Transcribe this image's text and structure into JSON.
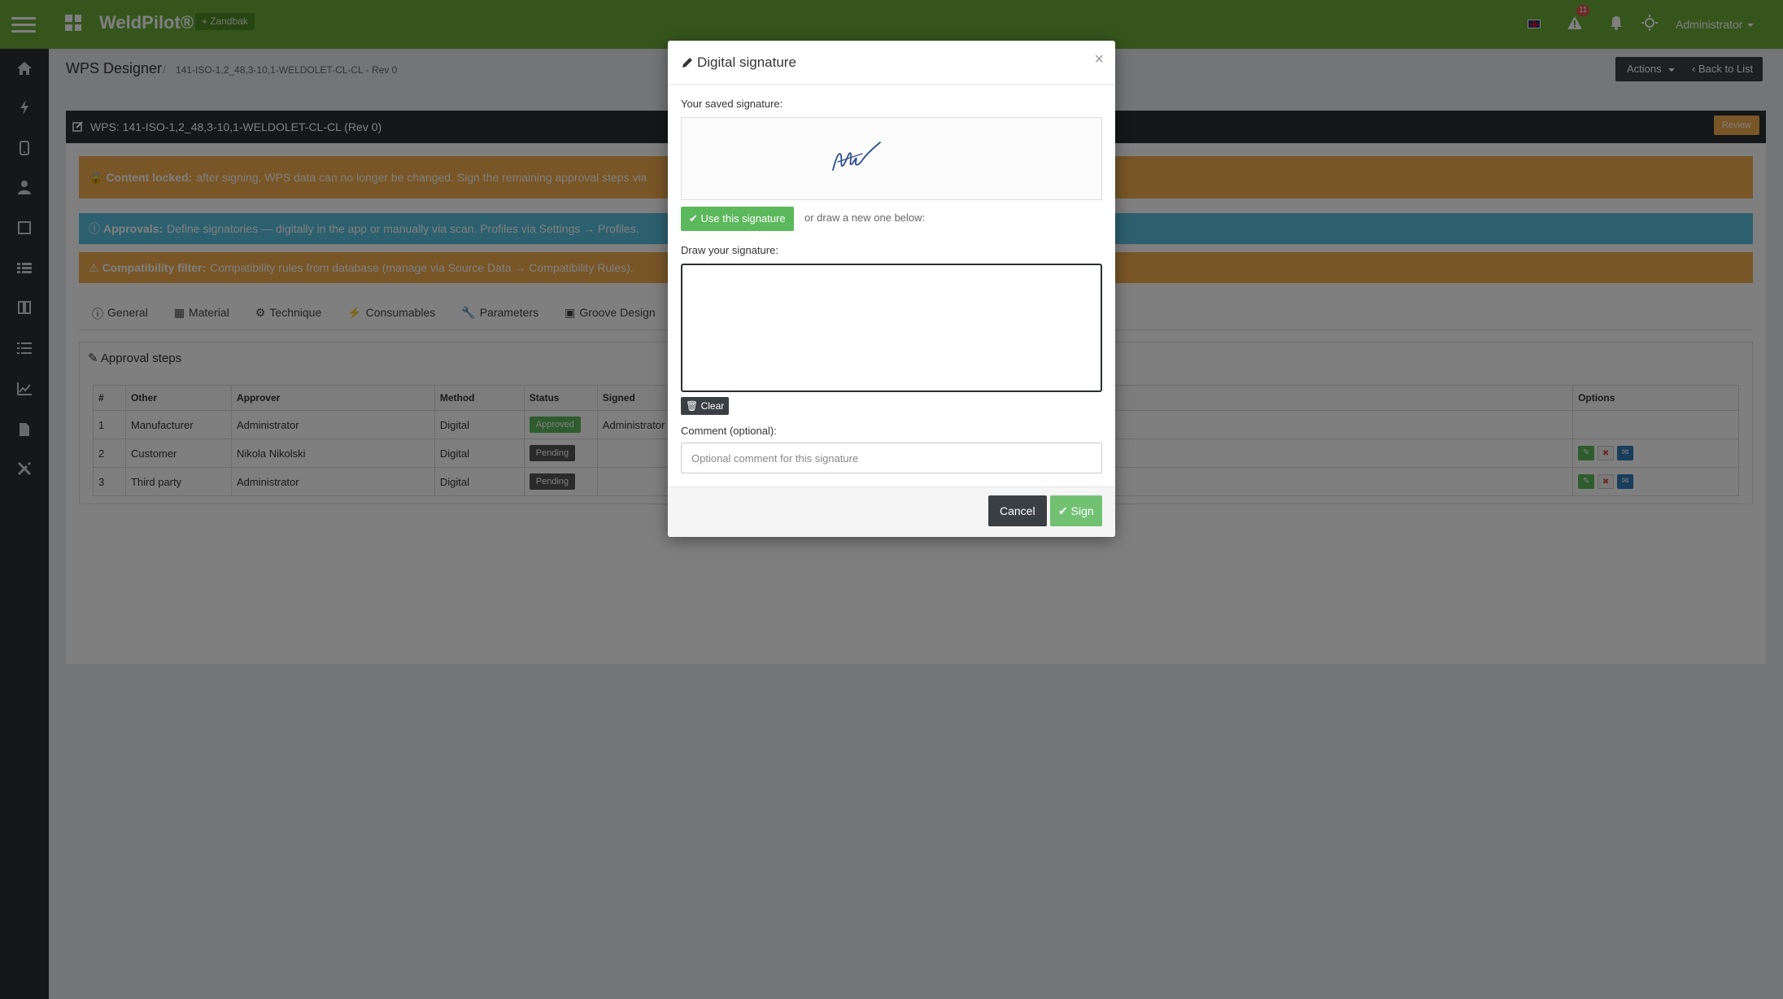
{
  "app": {
    "brand": "WeldPilot®",
    "environment": "Zandbak",
    "alert_count": "11",
    "user": "Administrator"
  },
  "page": {
    "title": "WPS Designer",
    "breadcrumb": "141-ISO-1,2_48,3-10,1-WELDOLET-CL-CL - Rev 0",
    "actions_label": "Actions",
    "back_label": "Back to List"
  },
  "panel": {
    "title": "WPS: 141-ISO-1,2_48,3-10,1-WELDOLET-CL-CL (Rev 0)",
    "review_label": "Review",
    "alerts": {
      "locked_strong": "Content locked:",
      "locked_text": "after signing, WPS data can no longer be changed. Sign the remaining approval steps via",
      "approvals_strong": "Approvals:",
      "approvals_text": "Define signatories — digitally in the app or manually via scan. Profiles via Settings → Profiles.",
      "compat_strong": "Compatibility filter:",
      "compat_text": "Compatibility rules from database (manage via Source Data → Compatibility Rules)."
    },
    "tabs": [
      "General",
      "Material",
      "Technique",
      "Consumables",
      "Parameters",
      "Groove Design"
    ],
    "approval_title": "Approval steps",
    "columns": [
      "#",
      "Other",
      "Approver",
      "Method",
      "Status",
      "Signed",
      "Options"
    ],
    "rows": [
      {
        "num": "1",
        "other": "Manufacturer",
        "approver": "Administrator",
        "method": "Digital",
        "status": "Approved",
        "signed": "Administrator"
      },
      {
        "num": "2",
        "other": "Customer",
        "approver": "Nikola Nikolski",
        "method": "Digital",
        "status": "Pending",
        "signed": ""
      },
      {
        "num": "3",
        "other": "Third party",
        "approver": "Administrator",
        "method": "Digital",
        "status": "Pending",
        "signed": ""
      }
    ]
  },
  "modal": {
    "title": "Digital signature",
    "close": "×",
    "saved_label": "Your saved signature:",
    "use_label": "Use this signature",
    "or_text": "or draw a new one below:",
    "draw_label": "Draw your signature:",
    "clear_label": "Clear",
    "comment_label": "Comment (optional):",
    "comment_placeholder": "Optional comment for this signature",
    "comment_value": "",
    "cancel_label": "Cancel",
    "sign_label": "Sign"
  },
  "colors": {
    "topbar": "#6aaa3a",
    "sidebar": "#2b2f33",
    "warning": "#f0ad4e",
    "info": "#5bc0de",
    "success": "#5cb85c"
  },
  "sidebar_icons": [
    "home-icon",
    "bolt-icon",
    "tablet-icon",
    "user-icon",
    "square-icon",
    "list-icon",
    "book-icon",
    "list-icon",
    "chart-icon",
    "file-icon",
    "tools-icon"
  ]
}
